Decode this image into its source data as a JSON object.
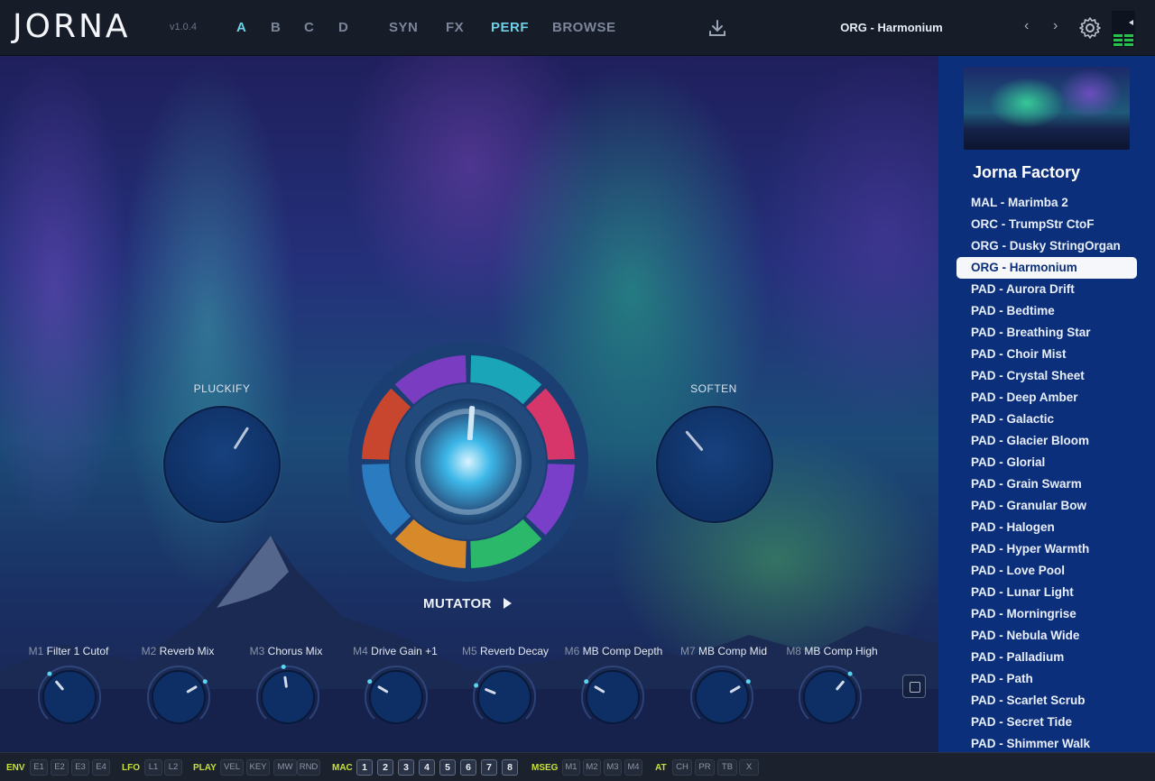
{
  "header": {
    "logo": "JORNA",
    "version": "v1.0.4",
    "slots": [
      "A",
      "B",
      "C",
      "D"
    ],
    "tabs": [
      "SYN",
      "FX",
      "PERF",
      "BROWSE"
    ],
    "active_tab": "PERF",
    "preset_name": "ORG - Harmonium",
    "prev_symbol": "‹",
    "next_symbol": "›"
  },
  "perf": {
    "left_knob_label": "PLUCKIFY",
    "right_knob_label": "SOFTEN",
    "left_knob_value": 0.62,
    "right_knob_value": 0.35,
    "mutator_label": "MUTATOR",
    "mutator_colors": [
      "#1aa6b8",
      "#d6366a",
      "#7a3fc8",
      "#2bb86a",
      "#d88a2a",
      "#2a7bc0",
      "#c8452e",
      "#7a3cc0"
    ]
  },
  "macros": [
    {
      "idx": "M1",
      "name": "Filter 1 Cutof",
      "value": 0.35
    },
    {
      "idx": "M2",
      "name": "Reverb Mix",
      "value": 0.72
    },
    {
      "idx": "M3",
      "name": "Chorus Mix",
      "value": 0.47
    },
    {
      "idx": "M4",
      "name": "Drive Gain +1",
      "value": 0.28
    },
    {
      "idx": "M5",
      "name": "Reverb Decay",
      "value": 0.25
    },
    {
      "idx": "M6",
      "name": "MB Comp Depth",
      "value": 0.28
    },
    {
      "idx": "M7",
      "name": "MB Comp Mid",
      "value": 0.72
    },
    {
      "idx": "M8",
      "name": "MB Comp High",
      "value": 0.65
    }
  ],
  "browser": {
    "bank": "Jorna Factory",
    "selected": "ORG - Harmonium",
    "presets": [
      "MAL - Marimba 2",
      "ORC - TrumpStr CtoF",
      "ORG - Dusky StringOrgan",
      "ORG - Harmonium",
      "PAD - Aurora Drift",
      "PAD - Bedtime",
      "PAD - Breathing Star",
      "PAD - Choir Mist",
      "PAD - Crystal Sheet",
      "PAD - Deep Amber",
      "PAD - Galactic",
      "PAD - Glacier Bloom",
      "PAD - Glorial",
      "PAD - Grain Swarm",
      "PAD - Granular Bow",
      "PAD - Halogen",
      "PAD - Hyper Warmth",
      "PAD - Love Pool",
      "PAD - Lunar Light",
      "PAD - Morningrise",
      "PAD - Nebula Wide",
      "PAD - Palladium",
      "PAD - Path",
      "PAD - Scarlet Scrub",
      "PAD - Secret Tide",
      "PAD - Shimmer Walk"
    ]
  },
  "mod_strip": {
    "env": {
      "label": "ENV",
      "items": [
        "E1",
        "E2",
        "E3",
        "E4"
      ]
    },
    "lfo": {
      "label": "LFO",
      "items": [
        "L1",
        "L2"
      ]
    },
    "play": {
      "label": "PLAY",
      "items": [
        "VEL",
        "KEY",
        "MW",
        "RND"
      ]
    },
    "mac": {
      "label": "MAC",
      "items": [
        "1",
        "2",
        "3",
        "4",
        "5",
        "6",
        "7",
        "8"
      ]
    },
    "mseg": {
      "label": "MSEG",
      "items": [
        "M1",
        "M2",
        "M3",
        "M4"
      ]
    },
    "at": {
      "label": "AT",
      "items": [
        "CH",
        "PR",
        "TB",
        "X"
      ]
    }
  }
}
